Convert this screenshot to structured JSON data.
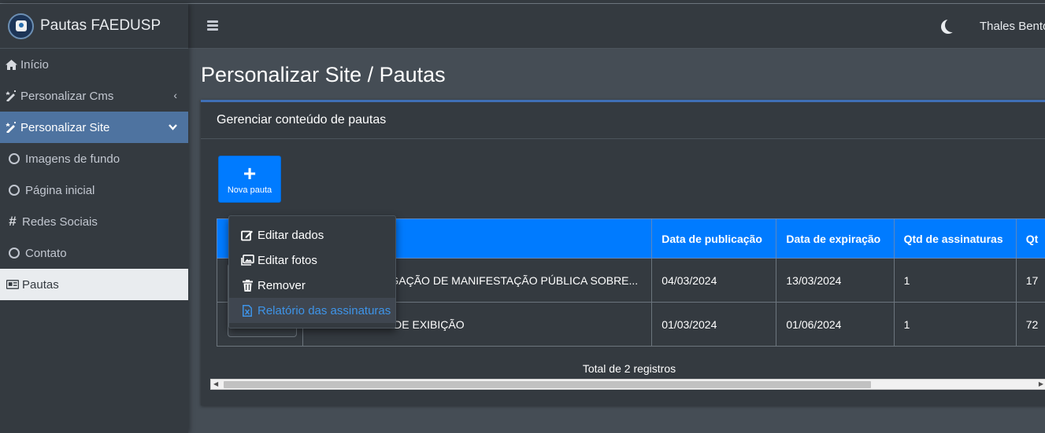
{
  "app": {
    "brand_title": "Pautas FAEDUSP"
  },
  "header": {
    "user_name": "Thales Bento"
  },
  "sidebar": {
    "items": [
      {
        "label": "Início",
        "icon": "home-icon"
      },
      {
        "label": "Personalizar Cms",
        "icon": "magic-icon",
        "arrow": "‹"
      },
      {
        "label": "Personalizar Site",
        "icon": "magic-icon",
        "arrow": "⌄",
        "active": true
      },
      {
        "label": "Imagens de fundo",
        "icon": "circle-icon"
      },
      {
        "label": "Página inicial",
        "icon": "circle-icon"
      },
      {
        "label": "Redes Sociais",
        "icon": "hashtag-icon"
      },
      {
        "label": "Contato",
        "icon": "circle-icon"
      },
      {
        "label": "Pautas",
        "icon": "newspaper-icon",
        "selected": true
      }
    ]
  },
  "main": {
    "page_title": "Personalizar Site / Pautas",
    "card_title": "Gerenciar conteúdo de pautas",
    "new_button": {
      "plus": "+",
      "label": "Nova pauta"
    },
    "table": {
      "columns": [
        "",
        "",
        "Data de publicação",
        "Data de expiração",
        "Qtd de assinaturas",
        "Qt"
      ],
      "rows": [
        [
          "",
          "VOGAÇÃO DE MANIFESTAÇÃO PÚBLICA SOBRE...",
          "04/03/2024",
          "13/03/2024",
          "1",
          "17"
        ],
        [
          "",
          "DE EXIBIÇÃO",
          "01/03/2024",
          "01/06/2024",
          "1",
          "72"
        ]
      ]
    },
    "total_text": "Total de 2 registros"
  },
  "dropdown": {
    "items": [
      {
        "label": "Editar dados",
        "icon": "edit-icon"
      },
      {
        "label": "Editar fotos",
        "icon": "images-icon"
      },
      {
        "label": "Remover",
        "icon": "trash-icon"
      },
      {
        "label": "Relatório das assinaturas",
        "icon": "file-excel-icon",
        "active": true
      }
    ]
  },
  "colors": {
    "sidebar_bg": "#343a40",
    "content_bg": "#454d55",
    "active_nav": "#4e73a0",
    "table_header": "#007bff",
    "link_active": "#3e94e8"
  }
}
